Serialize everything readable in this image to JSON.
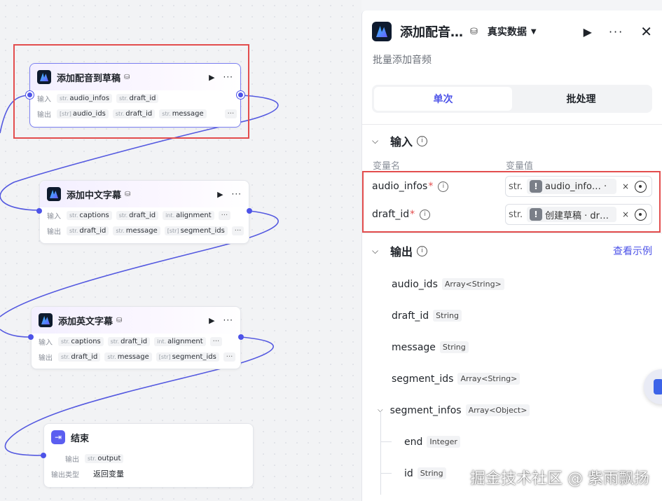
{
  "canvas": {
    "nodes": [
      {
        "title": "添加配音到草稿",
        "input_label": "输入",
        "inputs": [
          {
            "type": "str.",
            "name": "audio_infos"
          },
          {
            "type": "str.",
            "name": "draft_id"
          }
        ],
        "output_label": "输出",
        "outputs": [
          {
            "type": "[str]",
            "name": "audio_ids"
          },
          {
            "type": "str.",
            "name": "draft_id"
          },
          {
            "type": "str.",
            "name": "message"
          }
        ],
        "more": "···"
      },
      {
        "title": "添加中文字幕",
        "input_label": "输入",
        "inputs": [
          {
            "type": "str.",
            "name": "captions"
          },
          {
            "type": "str.",
            "name": "draft_id"
          },
          {
            "type": "int.",
            "name": "alignment"
          }
        ],
        "output_label": "输出",
        "outputs": [
          {
            "type": "str.",
            "name": "draft_id"
          },
          {
            "type": "str.",
            "name": "message"
          },
          {
            "type": "[str]",
            "name": "segment_ids"
          }
        ],
        "more": "···"
      },
      {
        "title": "添加英文字幕",
        "input_label": "输入",
        "inputs": [
          {
            "type": "str.",
            "name": "captions"
          },
          {
            "type": "str.",
            "name": "draft_id"
          },
          {
            "type": "int.",
            "name": "alignment"
          }
        ],
        "output_label": "输出",
        "outputs": [
          {
            "type": "str.",
            "name": "draft_id"
          },
          {
            "type": "str.",
            "name": "message"
          },
          {
            "type": "[str]",
            "name": "segment_ids"
          }
        ],
        "more": "···"
      }
    ],
    "end_node": {
      "title": "结束",
      "output_label": "输出",
      "output": {
        "type": "str.",
        "name": "output"
      },
      "output_type_label": "输出类型",
      "output_type_value": "返回变量"
    }
  },
  "panel": {
    "title": "添加配音…",
    "data_select": "真实数据",
    "description": "批量添加音频",
    "tabs": [
      "单次",
      "批处理"
    ],
    "input_section": "输入",
    "col_name": "变量名",
    "col_value": "变量值",
    "inputs": [
      {
        "name": "audio_infos",
        "type": "str.",
        "ref": "audio_info… ·"
      },
      {
        "name": "draft_id",
        "type": "str.",
        "ref": "创建草稿 · dr…"
      }
    ],
    "output_section": "输出",
    "view_example": "查看示例",
    "outputs": [
      {
        "name": "audio_ids",
        "type": "Array<String>"
      },
      {
        "name": "draft_id",
        "type": "String"
      },
      {
        "name": "message",
        "type": "String"
      },
      {
        "name": "segment_ids",
        "type": "Array<String>"
      },
      {
        "name": "segment_infos",
        "type": "Array<Object>"
      }
    ],
    "children": [
      {
        "name": "end",
        "type": "Integer"
      },
      {
        "name": "id",
        "type": "String"
      }
    ]
  },
  "watermark": "掘金技术社区 @ 紫雨飘扬",
  "colors": {
    "accent": "#4d53e8",
    "highlight": "#e34d4d"
  }
}
